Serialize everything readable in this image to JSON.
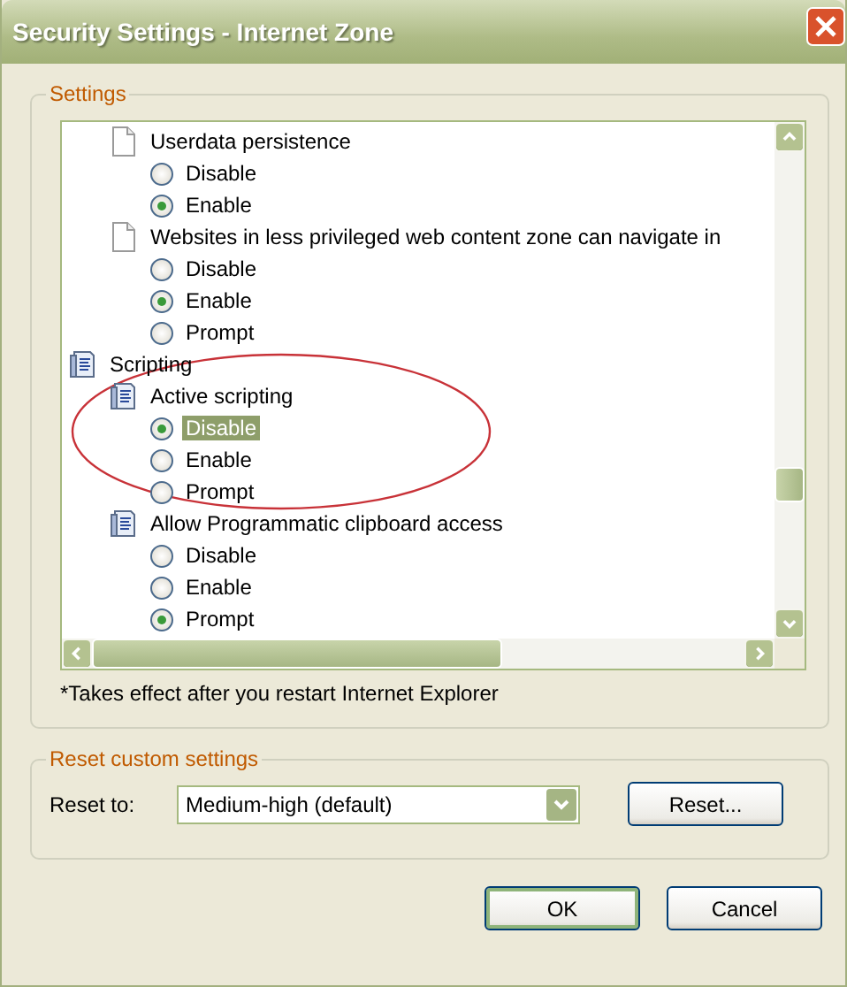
{
  "window": {
    "title": "Security Settings - Internet Zone"
  },
  "settings": {
    "label": "Settings",
    "tree": [
      {
        "kind": "continued",
        "children": [
          {
            "kind": "page_setting",
            "label": "Userdata persistence",
            "options": [
              {
                "label": "Disable",
                "selected": false,
                "highlighted": false
              },
              {
                "label": "Enable",
                "selected": true,
                "highlighted": false
              }
            ]
          },
          {
            "kind": "page_setting",
            "label": "Websites in less privileged web content zone can navigate in",
            "options": [
              {
                "label": "Disable",
                "selected": false,
                "highlighted": false
              },
              {
                "label": "Enable",
                "selected": true,
                "highlighted": false
              },
              {
                "label": "Prompt",
                "selected": false,
                "highlighted": false
              }
            ]
          }
        ]
      },
      {
        "kind": "category",
        "label": "Scripting",
        "children": [
          {
            "kind": "script_setting",
            "label": "Active scripting",
            "options": [
              {
                "label": "Disable",
                "selected": true,
                "highlighted": true
              },
              {
                "label": "Enable",
                "selected": false,
                "highlighted": false
              },
              {
                "label": "Prompt",
                "selected": false,
                "highlighted": false
              }
            ]
          },
          {
            "kind": "script_setting",
            "label": "Allow Programmatic clipboard access",
            "options": [
              {
                "label": "Disable",
                "selected": false,
                "highlighted": false
              },
              {
                "label": "Enable",
                "selected": false,
                "highlighted": false
              },
              {
                "label": "Prompt",
                "selected": true,
                "highlighted": false
              }
            ]
          }
        ]
      }
    ],
    "note": "*Takes effect after you restart Internet Explorer"
  },
  "reset": {
    "label": "Reset custom settings",
    "field_label": "Reset to:",
    "value": "Medium-high (default)",
    "button": "Reset..."
  },
  "buttons": [
    {
      "label": "OK",
      "default": true
    },
    {
      "label": "Cancel",
      "default": false
    }
  ]
}
